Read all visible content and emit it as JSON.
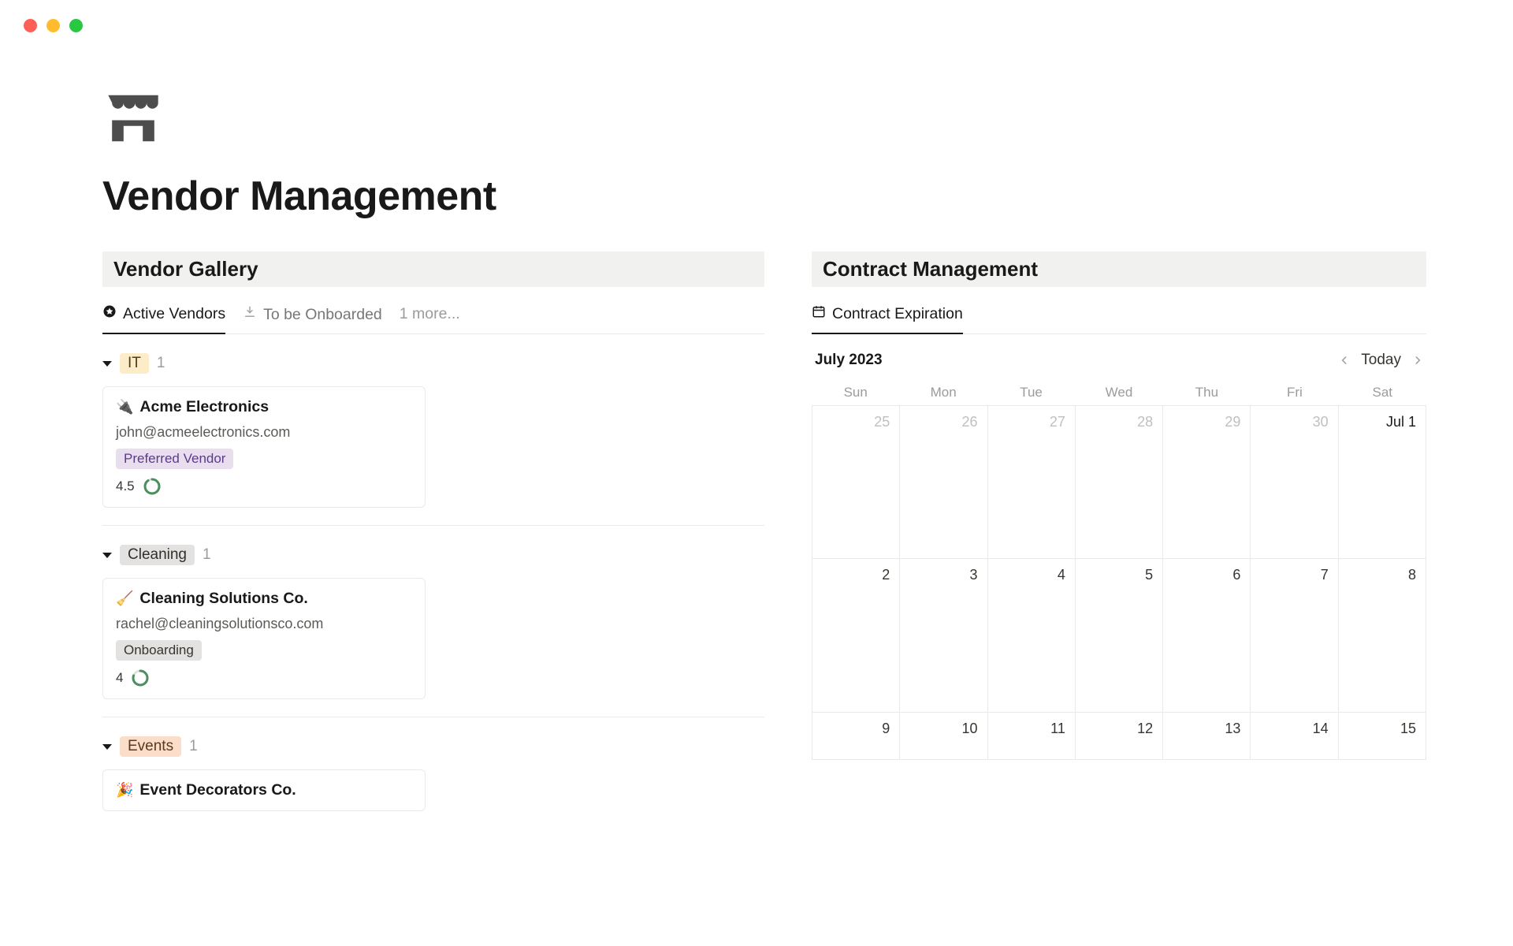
{
  "window": {
    "title": "Vendor Management"
  },
  "page": {
    "icon": "store-icon",
    "title": "Vendor Management"
  },
  "vendor_gallery": {
    "heading": "Vendor Gallery",
    "tabs": [
      {
        "label": "Active Vendors",
        "icon": "star-badge-icon",
        "active": true
      },
      {
        "label": "To be Onboarded",
        "icon": "download-icon",
        "active": false
      }
    ],
    "more_label": "1 more...",
    "groups": [
      {
        "tag": "IT",
        "tag_class": "tag-it",
        "count": "1",
        "cards": [
          {
            "icon": "🔌",
            "name": "Acme Electronics",
            "email": "john@acmeelectronics.com",
            "badge": "Preferred Vendor",
            "badge_class": "badge-preferred",
            "rating": "4.5",
            "ring_pct": 90
          }
        ]
      },
      {
        "tag": "Cleaning",
        "tag_class": "tag-cleaning",
        "count": "1",
        "cards": [
          {
            "icon": "🧹",
            "name": "Cleaning Solutions Co.",
            "email": "rachel@cleaningsolutionsco.com",
            "badge": "Onboarding",
            "badge_class": "badge-onboarding",
            "rating": "4",
            "ring_pct": 80
          }
        ]
      },
      {
        "tag": "Events",
        "tag_class": "tag-events",
        "count": "1",
        "cards": [
          {
            "icon": "🎉",
            "name": "Event Decorators Co.",
            "email": "",
            "badge": "",
            "badge_class": "",
            "rating": "",
            "ring_pct": 0
          }
        ]
      }
    ]
  },
  "contract_management": {
    "heading": "Contract Management",
    "tabs": [
      {
        "label": "Contract Expiration",
        "icon": "calendar-icon",
        "active": true
      }
    ],
    "calendar": {
      "month_label": "July 2023",
      "today_label": "Today",
      "dow": [
        "Sun",
        "Mon",
        "Tue",
        "Wed",
        "Thu",
        "Fri",
        "Sat"
      ],
      "rows": [
        [
          {
            "label": "25",
            "other": true
          },
          {
            "label": "26",
            "other": true
          },
          {
            "label": "27",
            "other": true
          },
          {
            "label": "28",
            "other": true
          },
          {
            "label": "29",
            "other": true
          },
          {
            "label": "30",
            "other": true
          },
          {
            "label": "Jul 1",
            "first": true
          }
        ],
        [
          {
            "label": "2"
          },
          {
            "label": "3"
          },
          {
            "label": "4"
          },
          {
            "label": "5"
          },
          {
            "label": "6"
          },
          {
            "label": "7"
          },
          {
            "label": "8"
          }
        ],
        [
          {
            "label": "9"
          },
          {
            "label": "10"
          },
          {
            "label": "11"
          },
          {
            "label": "12"
          },
          {
            "label": "13"
          },
          {
            "label": "14"
          },
          {
            "label": "15"
          }
        ]
      ]
    }
  }
}
